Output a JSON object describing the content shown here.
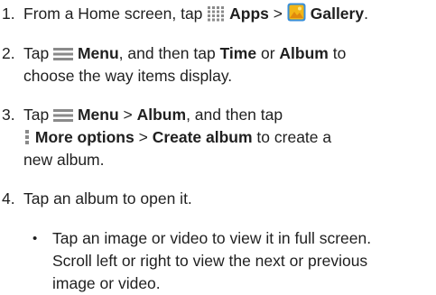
{
  "steps": [
    {
      "number": "1.",
      "pre": "From a Home screen, tap ",
      "apps": "Apps",
      "sep": " > ",
      "gallery": "Gallery",
      "post": "."
    },
    {
      "number": "2.",
      "line1_pre": "Tap ",
      "menu": "Menu",
      "line1_mid": ", and then tap ",
      "time": "Time",
      "or": " or ",
      "album": "Album",
      "line1_post": " to",
      "line2": "choose the way items display."
    },
    {
      "number": "3.",
      "line1_pre": "Tap ",
      "menu": "Menu",
      "sep": " > ",
      "album": "Album",
      "line1_post": ", and then tap",
      "more": "More options",
      "sep2": " > ",
      "create": "Create album",
      "line2_post": " to create a",
      "line3": "new album."
    },
    {
      "number": "4.",
      "text": "Tap an album to open it."
    }
  ],
  "bullet": {
    "symbol": "•",
    "line1": "Tap an image or video to view it in full screen.",
    "line2": "Scroll left or right to view the next or previous",
    "line3": "image or video."
  },
  "icons": {
    "apps": "apps-grid-icon",
    "gallery": "gallery-icon",
    "menu": "menu-icon",
    "more": "more-options-icon"
  },
  "colors": {
    "icon_gray": "#8a8a8a",
    "gallery_yellow": "#f2b616",
    "gallery_blue": "#3a8fd8"
  }
}
